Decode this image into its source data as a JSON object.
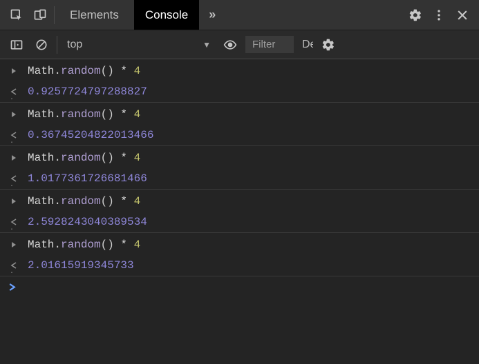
{
  "toolbar": {
    "tabs": {
      "elements": "Elements",
      "console": "Console"
    },
    "more_chevron": "»"
  },
  "subbar": {
    "context": "top",
    "filter_placeholder": "Filter",
    "levels_label": "Default levels"
  },
  "entries": [
    {
      "inputObj": "Math",
      "inputFunc": "random",
      "inputParens": "()",
      "inputOp": " * ",
      "inputNum": "4",
      "output": "0.9257724797288827"
    },
    {
      "inputObj": "Math",
      "inputFunc": "random",
      "inputParens": "()",
      "inputOp": " * ",
      "inputNum": "4",
      "output": "0.36745204822013466"
    },
    {
      "inputObj": "Math",
      "inputFunc": "random",
      "inputParens": "()",
      "inputOp": " * ",
      "inputNum": "4",
      "output": "1.0177361726681466"
    },
    {
      "inputObj": "Math",
      "inputFunc": "random",
      "inputParens": "()",
      "inputOp": " * ",
      "inputNum": "4",
      "output": "2.5928243040389534"
    },
    {
      "inputObj": "Math",
      "inputFunc": "random",
      "inputParens": "()",
      "inputOp": " * ",
      "inputNum": "4",
      "output": "2.01615919345733"
    }
  ]
}
